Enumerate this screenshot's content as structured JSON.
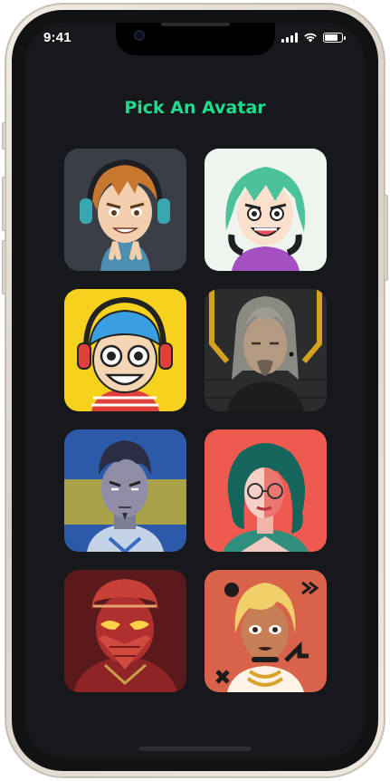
{
  "status_bar": {
    "time": "9:41",
    "battery_level": 0.9
  },
  "page": {
    "title": "Pick An Avatar"
  },
  "avatars": [
    {
      "name": "brown-hair-headphones",
      "bg": "#3a3f47"
    },
    {
      "name": "green-hair-headphones",
      "bg": "#eef5ee"
    },
    {
      "name": "blue-hair-headphones",
      "bg": "#f6d21e"
    },
    {
      "name": "grey-hair-man",
      "bg": "#2b2c2e"
    },
    {
      "name": "serious-young-man",
      "bg": "#2d5aa8"
    },
    {
      "name": "teal-hair-woman",
      "bg": "#ef5a50"
    },
    {
      "name": "masked-red-figure",
      "bg": "#5a1a1c"
    },
    {
      "name": "blonde-woman-chains",
      "bg": "#d9634a"
    }
  ]
}
